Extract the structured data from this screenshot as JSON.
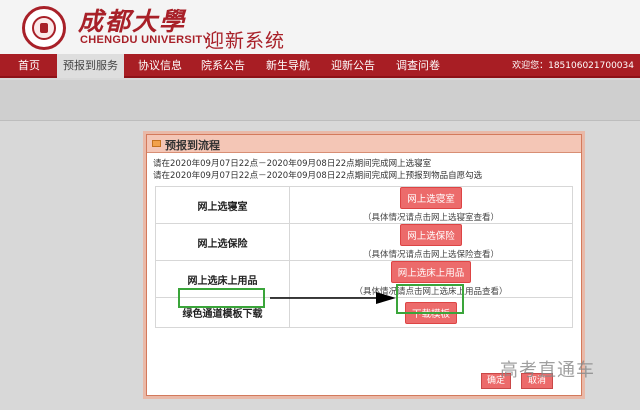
{
  "header": {
    "logo_cn": "成都大學",
    "logo_en": "CHENGDU UNIVERSITY",
    "site_title": "迎新系统"
  },
  "nav": {
    "items": [
      "首页",
      "预报到服务",
      "协议信息",
      "院系公告",
      "新生导航",
      "迎新公告",
      "调查问卷"
    ],
    "active": "预报到服务",
    "welcome": "欢迎您：185106021700034"
  },
  "dialog": {
    "title": "预报到流程",
    "notes": [
      "请在2020年09月07日22点－2020年09月08日22点期间完成网上选寝室",
      "请在2020年09月07日22点－2020年09月08日22点期间完成网上预报到物品自愿勾选"
    ],
    "rows": [
      {
        "label": "网上选寝室",
        "button": "网上选寝室",
        "hint": "（具体情况请点击网上选寝室查看）"
      },
      {
        "label": "网上选保险",
        "button": "网上选保险",
        "hint": "（具体情况请点击网上选保险查看）"
      },
      {
        "label": "网上选床上用品",
        "button": "网上选床上用品",
        "hint": "（具体情况请点击网上选床上用品查看）"
      },
      {
        "label": "绿色通道模板下载",
        "button": "下载模板",
        "hint": ""
      }
    ],
    "confirm": "确定",
    "cancel": "取消"
  },
  "watermark": "高考直通车",
  "colors": {
    "brand_red": "#a81e24",
    "button_red": "#ec6b6b",
    "highlight_green": "#3aa53a"
  }
}
